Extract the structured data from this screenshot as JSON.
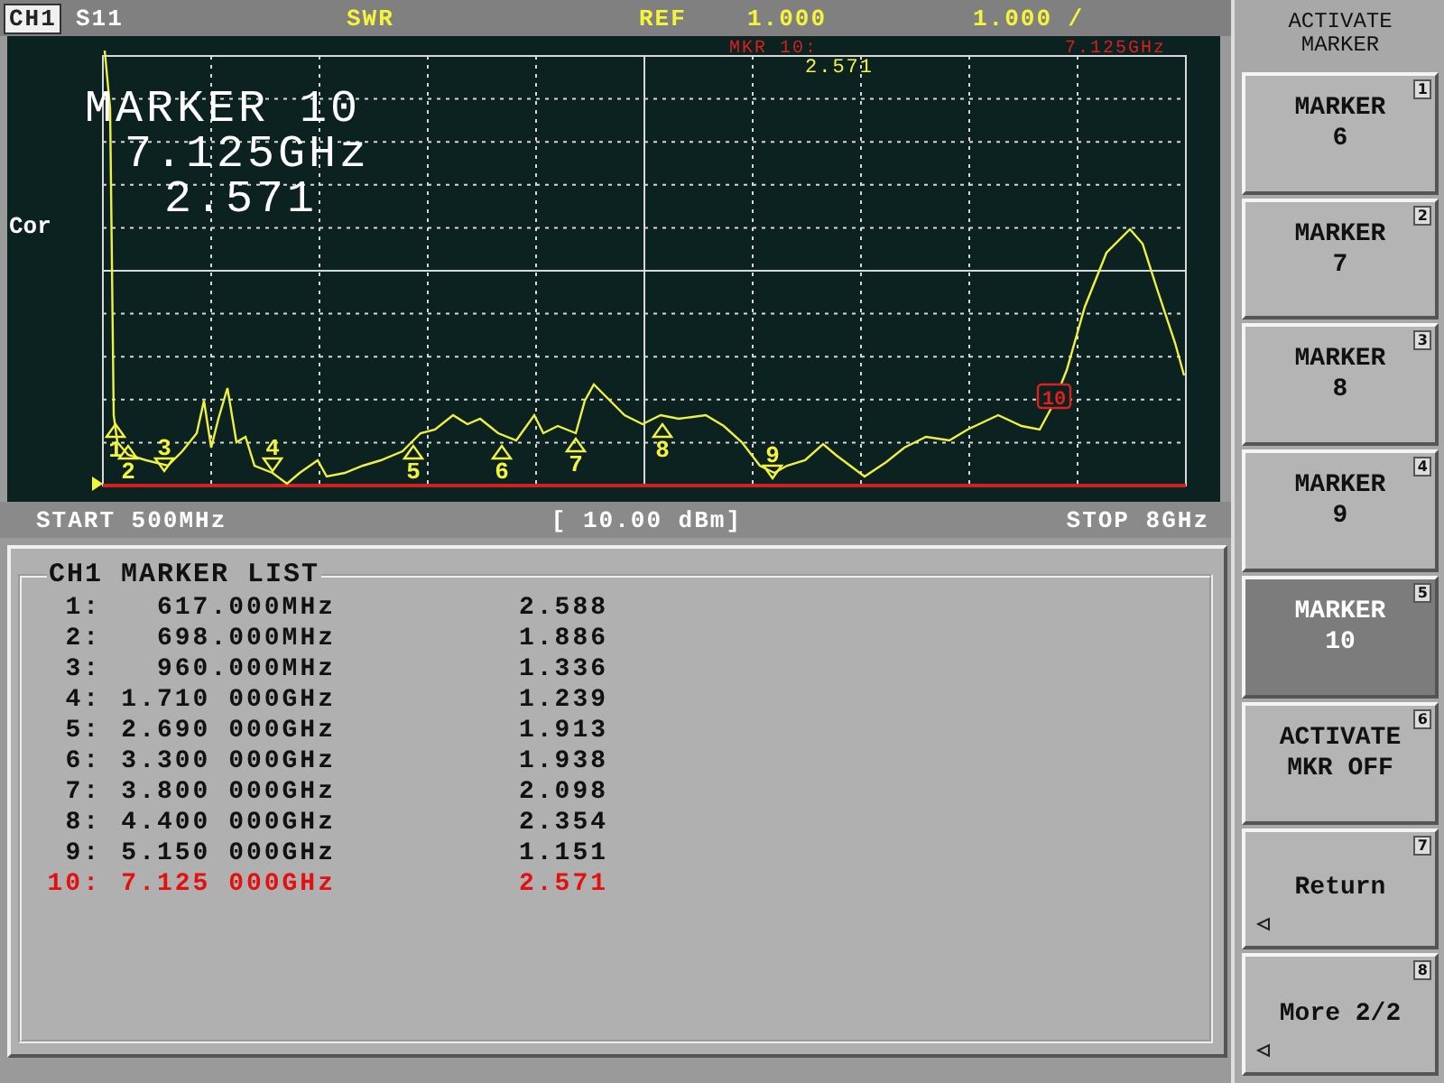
{
  "header": {
    "channel": "CH1",
    "parameter": "S11",
    "format": "SWR",
    "ref_label": "REF",
    "ref_value": "1.000",
    "scale": "1.000 /"
  },
  "plot": {
    "side_label": "Cor",
    "marker_readout": {
      "title": "MARKER 10",
      "frequency": "7.125GHz",
      "value": "2.571"
    },
    "marker_annotation": {
      "label": "MKR 10:",
      "value": "2.571",
      "frequency": "7.125GHz"
    },
    "markers": [
      {
        "label": "1",
        "kind": "up",
        "selected": false
      },
      {
        "label": "2",
        "kind": "up",
        "selected": false
      },
      {
        "label": "3",
        "kind": "down",
        "selected": false
      },
      {
        "label": "4",
        "kind": "down",
        "selected": false
      },
      {
        "label": "5",
        "kind": "up",
        "selected": false
      },
      {
        "label": "6",
        "kind": "up",
        "selected": false
      },
      {
        "label": "7",
        "kind": "up",
        "selected": false
      },
      {
        "label": "8",
        "kind": "up",
        "selected": false
      },
      {
        "label": "9",
        "kind": "down",
        "selected": false
      },
      {
        "label": "10",
        "kind": "box",
        "selected": true
      }
    ]
  },
  "footer": {
    "start": "START 500MHz",
    "power": "[ 10.00 dBm]",
    "stop": "STOP 8GHz"
  },
  "marker_list": {
    "title": "CH1 MARKER LIST",
    "rows": [
      {
        "index": "1:",
        "frequency": "617.000MHz",
        "value": "2.588",
        "selected": false
      },
      {
        "index": "2:",
        "frequency": "698.000MHz",
        "value": "1.886",
        "selected": false
      },
      {
        "index": "3:",
        "frequency": "960.000MHz",
        "value": "1.336",
        "selected": false
      },
      {
        "index": "4:",
        "frequency": "1.710 000GHz",
        "value": "1.239",
        "selected": false
      },
      {
        "index": "5:",
        "frequency": "2.690 000GHz",
        "value": "1.913",
        "selected": false
      },
      {
        "index": "6:",
        "frequency": "3.300 000GHz",
        "value": "1.938",
        "selected": false
      },
      {
        "index": "7:",
        "frequency": "3.800 000GHz",
        "value": "2.098",
        "selected": false
      },
      {
        "index": "8:",
        "frequency": "4.400 000GHz",
        "value": "2.354",
        "selected": false
      },
      {
        "index": "9:",
        "frequency": "5.150 000GHz",
        "value": "1.151",
        "selected": false
      },
      {
        "index": "10:",
        "frequency": "7.125 000GHz",
        "value": "2.571",
        "selected": true
      }
    ]
  },
  "softkeys": {
    "title": "ACTIVATE MARKER",
    "keys": [
      {
        "lines": [
          "MARKER",
          "6"
        ],
        "number": "1",
        "selected": false,
        "submenu": false
      },
      {
        "lines": [
          "MARKER",
          "7"
        ],
        "number": "2",
        "selected": false,
        "submenu": false
      },
      {
        "lines": [
          "MARKER",
          "8"
        ],
        "number": "3",
        "selected": false,
        "submenu": false
      },
      {
        "lines": [
          "MARKER",
          "9"
        ],
        "number": "4",
        "selected": false,
        "submenu": false
      },
      {
        "lines": [
          "MARKER",
          "10"
        ],
        "number": "5",
        "selected": true,
        "submenu": false
      },
      {
        "lines": [
          "ACTIVATE",
          "MKR OFF"
        ],
        "number": "6",
        "selected": false,
        "submenu": false
      },
      {
        "lines": [
          "Return"
        ],
        "number": "7",
        "selected": false,
        "submenu": true
      },
      {
        "lines": [
          "More 2/2"
        ],
        "number": "8",
        "selected": false,
        "submenu": true
      }
    ]
  }
}
